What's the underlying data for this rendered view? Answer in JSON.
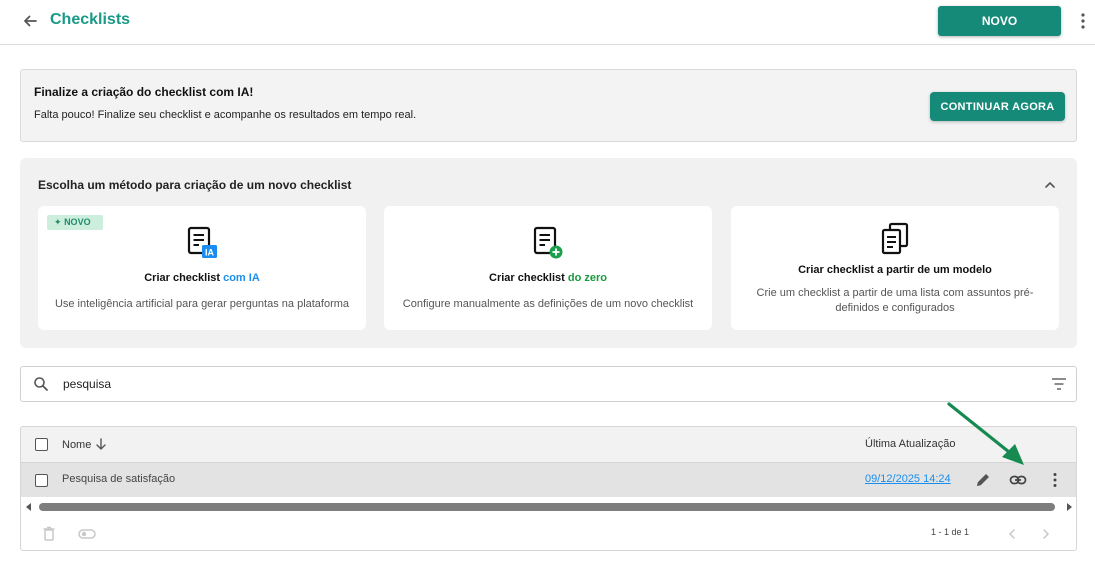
{
  "header": {
    "title": "Checklists",
    "new_button": "NOVO"
  },
  "banner": {
    "title": "Finalize a criação do checklist com IA!",
    "text": "Falta pouco! Finalize seu checklist e acompanhe os resultados em tempo real.",
    "button": "CONTINUAR AGORA"
  },
  "methods": {
    "title": "Escolha um método para criação de um novo checklist",
    "cards": [
      {
        "badge": "NOVO",
        "title_prefix": "Criar checklist ",
        "title_accent": "com IA",
        "icon_tag": "IA",
        "description": "Use inteligência artificial para gerar perguntas na plataforma"
      },
      {
        "title_prefix": "Criar checklist ",
        "title_accent": "do zero",
        "description": "Configure manualmente as definições de um novo checklist"
      },
      {
        "title": "Criar checklist a partir de um modelo",
        "description": "Crie um checklist a partir de uma lista com assuntos pré-definidos e configurados"
      }
    ]
  },
  "search": {
    "value": "pesquisa"
  },
  "table": {
    "columns": {
      "name": "Nome",
      "updated": "Última Atualização"
    },
    "rows": [
      {
        "name": "Pesquisa de satisfação",
        "updated": "09/12/2025 14:24"
      }
    ],
    "pagination": "1 - 1 de 1"
  },
  "colors": {
    "brand": "#168a78",
    "title": "#1a9a86",
    "link": "#1a8ef0",
    "annotation_arrow": "#168a50"
  },
  "icons": [
    "back-arrow-icon",
    "more-vert-icon",
    "chevron-up-icon",
    "ai-doc-icon",
    "doc-plus-icon",
    "doc-copy-icon",
    "search-icon",
    "filter-icon",
    "sort-down-icon",
    "edit-icon",
    "link-icon",
    "trash-icon",
    "toggle-icon",
    "chevron-left-icon",
    "chevron-right-icon",
    "sparkle-icon"
  ]
}
